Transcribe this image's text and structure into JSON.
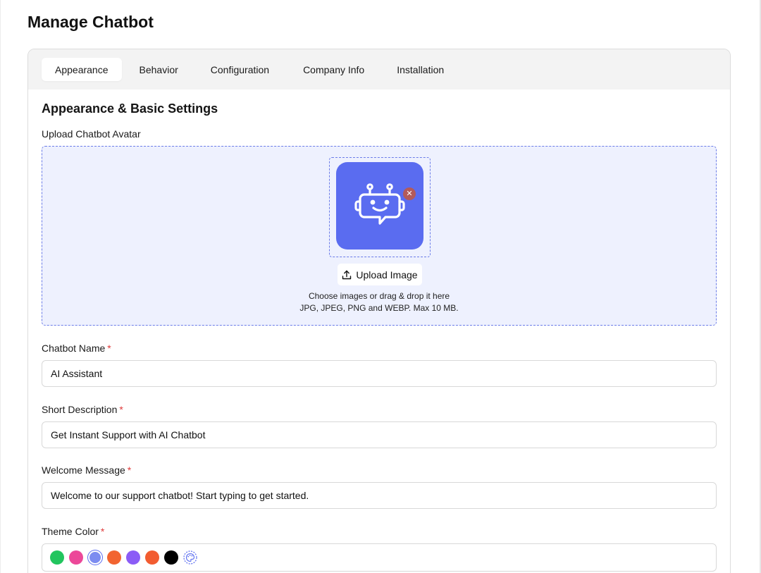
{
  "page": {
    "title": "Manage Chatbot"
  },
  "tabs": [
    {
      "label": "Appearance",
      "active": true
    },
    {
      "label": "Behavior",
      "active": false
    },
    {
      "label": "Configuration",
      "active": false
    },
    {
      "label": "Company Info",
      "active": false
    },
    {
      "label": "Installation",
      "active": false
    }
  ],
  "section": {
    "title": "Appearance & Basic Settings"
  },
  "avatar": {
    "label": "Upload Chatbot Avatar",
    "upload_button": "Upload Image",
    "hint_line1": "Choose images or drag & drop it here",
    "hint_line2": "JPG, JPEG, PNG and WEBP. Max 10 MB.",
    "remove_icon": "close-icon",
    "image_color": "#5a6cf0"
  },
  "fields": {
    "name": {
      "label": "Chatbot Name",
      "value": "AI Assistant",
      "required": "*"
    },
    "description": {
      "label": "Short Description",
      "value": "Get Instant Support with AI Chatbot",
      "required": "*"
    },
    "welcome": {
      "label": "Welcome Message",
      "value": "Welcome to our support chatbot! Start typing to get started.",
      "required": "*"
    },
    "theme": {
      "label": "Theme Color",
      "required": "*"
    }
  },
  "theme_colors": [
    {
      "name": "green",
      "hex": "#22c55e"
    },
    {
      "name": "pink",
      "hex": "#ec4899"
    },
    {
      "name": "indigo",
      "hex": "#7c8cf0",
      "selected": true
    },
    {
      "name": "orange",
      "hex": "#f26430"
    },
    {
      "name": "purple",
      "hex": "#8b5cf6"
    },
    {
      "name": "orange-red",
      "hex": "#f25c30"
    },
    {
      "name": "black",
      "hex": "#000000"
    }
  ],
  "custom_color_icon": "palette-icon"
}
